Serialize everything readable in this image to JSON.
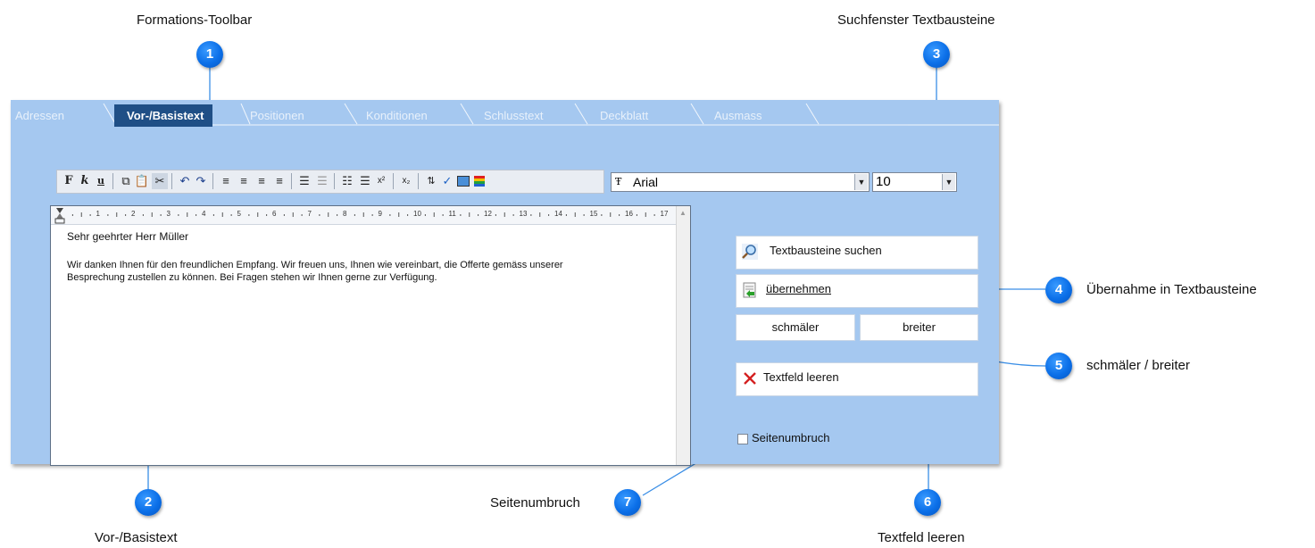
{
  "callouts": [
    {
      "num": "1",
      "label": "Formations-Toolbar"
    },
    {
      "num": "2",
      "label": "Vor-/Basistext"
    },
    {
      "num": "3",
      "label": "Suchfenster Textbausteine"
    },
    {
      "num": "4",
      "label": "Übernahme in Textbausteine"
    },
    {
      "num": "5",
      "label": "schmäler / breiter"
    },
    {
      "num": "6",
      "label": "Textfeld leeren"
    },
    {
      "num": "7",
      "label": "Seitenumbruch"
    }
  ],
  "tabs": [
    "Adressen",
    "Vor-/Basistext",
    "Positionen",
    "Konditionen",
    "Schlusstext",
    "Deckblatt",
    "Ausmass"
  ],
  "active_tab": "Vor-/Basistext",
  "toolbar": {
    "font": "Arial",
    "size": "10"
  },
  "editor": {
    "ruler_numbers": [
      "1",
      "2",
      "3",
      "4",
      "5",
      "6",
      "7",
      "8",
      "9",
      "10",
      "11",
      "12",
      "13",
      "14",
      "15",
      "16",
      "17"
    ],
    "greeting": "Sehr geehrter Herr Müller",
    "line1": "Wir danken Ihnen für den freundlichen Empfang. Wir freuen uns, Ihnen wie vereinbart, die Offerte gemäss unserer",
    "line2": "Besprechung zustellen zu können. Bei Fragen stehen wir Ihnen gerne zur Verfügung."
  },
  "panel": {
    "search_label": "Textbausteine suchen",
    "apply_label": "übernehmen",
    "narrower_label": "schmäler",
    "wider_label": "breiter",
    "clear_label": "Textfeld leeren",
    "pagebreak_label": "Seitenumbruch",
    "pagebreak_checked": false
  },
  "colors": {
    "badge": "#0b6fe8",
    "window_bg": "#a5c8f0",
    "active_tab": "#1f4f86",
    "callout_line": "#3a8ee6"
  }
}
